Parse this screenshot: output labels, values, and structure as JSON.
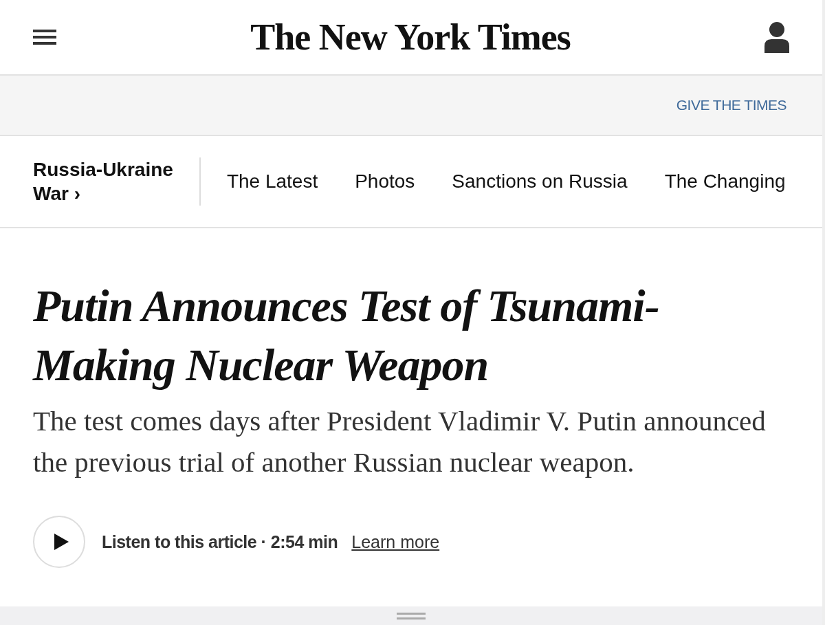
{
  "masthead": {
    "logo": "The New York Times"
  },
  "promo_bar": {
    "link": "GIVE THE TIMES"
  },
  "section_nav": {
    "section": "Russia-Ukraine War",
    "chevron": "›",
    "items": [
      {
        "label": "The Latest"
      },
      {
        "label": "Photos"
      },
      {
        "label": "Sanctions on Russia"
      },
      {
        "label": "The Changing"
      }
    ]
  },
  "article": {
    "headline": "Putin Announces Test of Tsunami-Making Nuclear Weapon",
    "summary": "The test comes days after President Vladimir V. Putin announced the previous trial of another Russian nuclear weapon.",
    "audio": {
      "label": "Listen to this article · 2:54 min",
      "link": "Learn more"
    }
  }
}
